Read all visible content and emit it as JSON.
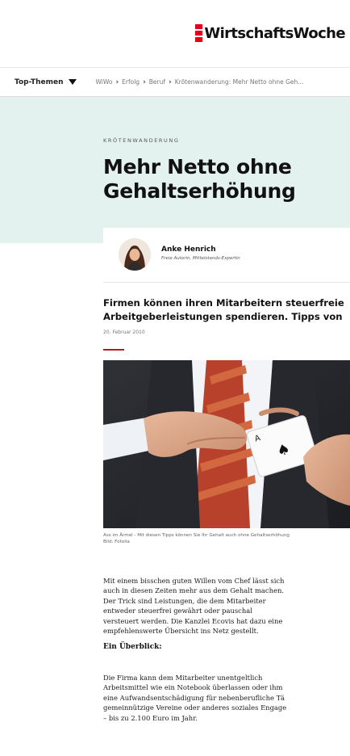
{
  "header": {
    "logo_text": "WirtschaftsWoche",
    "brand_color": "#e3001b"
  },
  "nav": {
    "topics_label": "Top-Themen",
    "breadcrumbs": [
      "WiWo",
      "Erfolg",
      "Beruf",
      "Krötenwanderung: Mehr Netto ohne Geh..."
    ]
  },
  "article": {
    "kicker": "KRÖTENWANDERUNG",
    "title_line1": "Mehr Netto ohne",
    "title_line2": "Gehaltserhöhung",
    "hero_bg": "#e3f2ee",
    "author": {
      "name": "Anke Henrich",
      "role": "Freie Autorin, Mittelstands-Expertin"
    },
    "teaser_line1": "Firmen können ihren Mitarbeitern steuerfreie",
    "teaser_line2": "Arbeitgeberleistungen spendieren. Tipps von",
    "date": "20. Februar 2010",
    "caption_line1": "Ass im Ärmel - Mit diesen Tipps können Sie Ihr Gehalt auch ohne Gehaltserhöhung",
    "caption_line2": "Bild:  Fotolia",
    "paragraph1": [
      "Mit einem bisschen guten Willen vom Chef lässt sich",
      "auch in diesen Zeiten mehr aus dem Gehalt machen.",
      "Der Trick sind Leistungen, die dem Mitarbeiter",
      "entweder steuerfrei gewährt oder pauschal",
      "versteuert werden. Die Kanzlei Ecovis hat dazu eine",
      "empfehlenswerte Übersicht ins Netz gestellt."
    ],
    "subheading": "Ein Überblick:",
    "paragraph2": [
      "Die Firma kann dem Mitarbeiter unentgeltlich",
      "Arbeitsmittel wie ein Notebook überlassen oder ihm",
      "eine Aufwandsentschädigung für nebenberufliche Tä",
      "gemeinnützige Vereine oder anderes soziales Engage",
      "– bis zu 2.100 Euro im Jahr."
    ]
  }
}
